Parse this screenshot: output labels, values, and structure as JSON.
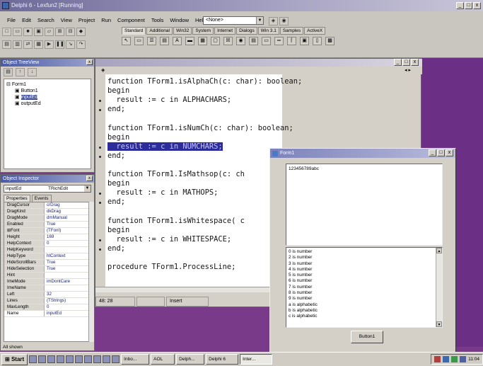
{
  "ide": {
    "title": "Delphi 6 - Lexfun2 [Running]",
    "menu": [
      "File",
      "Edit",
      "Search",
      "View",
      "Project",
      "Run",
      "Component",
      "Tools",
      "Window",
      "Help"
    ],
    "component_combo": "<None>",
    "palette_tabs": [
      "Standard",
      "Additional",
      "Win32",
      "System",
      "Internet",
      "Dialogs",
      "Win 3.1",
      "Samples",
      "ActiveX"
    ],
    "active_palette_tab": "Standard"
  },
  "treeview": {
    "title": "Object TreeView",
    "root": "Form1",
    "children": [
      "Button1",
      "inputEd",
      "outputEd"
    ],
    "selected": "inputEd"
  },
  "inspector": {
    "title": "Object Inspector",
    "object": "inputEd",
    "object_type": "TRichEdit",
    "tabs": [
      "Properties",
      "Events"
    ],
    "properties": [
      {
        "name": "DragCursor",
        "value": "crDrag"
      },
      {
        "name": "DragKind",
        "value": "dkDrag"
      },
      {
        "name": "DragMode",
        "value": "dmManual"
      },
      {
        "name": "Enabled",
        "value": "True"
      },
      {
        "name": "⊞Font",
        "value": "(TFont)"
      },
      {
        "name": "Height",
        "value": "169"
      },
      {
        "name": "HelpContext",
        "value": "0"
      },
      {
        "name": "HelpKeyword",
        "value": ""
      },
      {
        "name": "HelpType",
        "value": "htContext"
      },
      {
        "name": "HideScrollBars",
        "value": "True"
      },
      {
        "name": "HideSelection",
        "value": "True"
      },
      {
        "name": "Hint",
        "value": ""
      },
      {
        "name": "ImeMode",
        "value": "imDontCare"
      },
      {
        "name": "ImeName",
        "value": ""
      },
      {
        "name": "Left",
        "value": "32"
      },
      {
        "name": "Lines",
        "value": "(TStrings)"
      },
      {
        "name": "MaxLength",
        "value": "0"
      },
      {
        "name": "Name",
        "value": "inputEd"
      }
    ],
    "status": "All shown"
  },
  "editor": {
    "status_position": "48: 28",
    "status_mode": "Insert",
    "lines": [
      {
        "text": "function TForm1.isAlphaCh(c: char): boolean;",
        "dot": false,
        "hl": false
      },
      {
        "text": "begin",
        "dot": false,
        "hl": false
      },
      {
        "text": "  result := c in ALPHACHARS;",
        "dot": true,
        "hl": false
      },
      {
        "text": "end;",
        "dot": true,
        "hl": false
      },
      {
        "text": "",
        "dot": false,
        "hl": false
      },
      {
        "text": "function TForm1.isNumCh(c: char): boolean;",
        "dot": false,
        "hl": false
      },
      {
        "text": "begin",
        "dot": false,
        "hl": false
      },
      {
        "text": "  result := c in NUMCHARS;",
        "dot": true,
        "hl": true
      },
      {
        "text": "end;",
        "dot": true,
        "hl": false
      },
      {
        "text": "",
        "dot": false,
        "hl": false
      },
      {
        "text": "function TForm1.IsMathsop(c: ch",
        "dot": false,
        "hl": false
      },
      {
        "text": "begin",
        "dot": false,
        "hl": false
      },
      {
        "text": "  result := c in MATHOPS;",
        "dot": true,
        "hl": false
      },
      {
        "text": "end;",
        "dot": true,
        "hl": false
      },
      {
        "text": "",
        "dot": false,
        "hl": false
      },
      {
        "text": "function TForm1.isWhitespace( c",
        "dot": false,
        "hl": false
      },
      {
        "text": "begin",
        "dot": false,
        "hl": false
      },
      {
        "text": "  result := c in WHITESPACE;",
        "dot": true,
        "hl": false
      },
      {
        "text": "end;",
        "dot": true,
        "hl": false
      },
      {
        "text": "",
        "dot": false,
        "hl": false
      },
      {
        "text": "procedure TForm1.ProcessLine;",
        "dot": false,
        "hl": false
      }
    ]
  },
  "form1": {
    "title": "Form1",
    "input_text": "123456789abc",
    "output_lines": [
      "0 is number",
      "2 is number",
      "3 is number",
      "4 is number",
      "5 is number",
      "6 is number",
      "7 is number",
      "8 is number",
      "9 is number",
      "a is alphabetic",
      "b is alphabetic",
      "c is alphabetic"
    ],
    "button_label": "Button1"
  },
  "taskbar": {
    "start_label": "Start",
    "tasks": [
      "Inbo...",
      "AOL",
      "Delph...",
      "Delphi 6",
      "Inter..."
    ],
    "active_task": "Inter...",
    "clock": "11:04"
  },
  "window_buttons": {
    "min": "_",
    "max": "□",
    "close": "x"
  }
}
